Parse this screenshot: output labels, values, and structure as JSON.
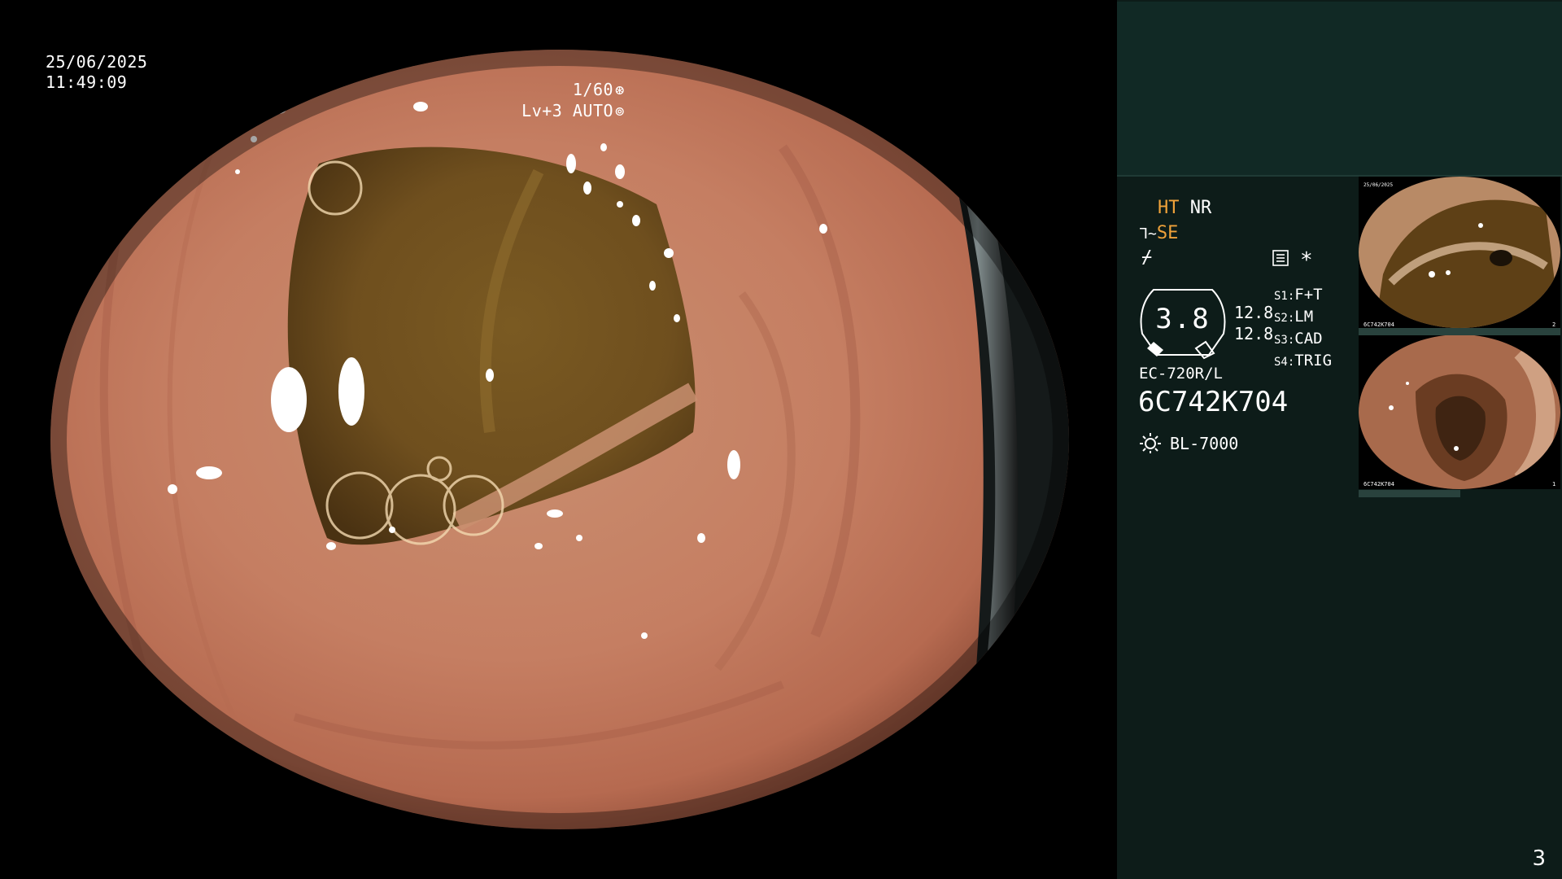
{
  "osd": {
    "date": "25/06/2025",
    "time": "11:49:09",
    "shutter": "1/60",
    "shutter_icon": "aperture-icon",
    "level": "Lv+3",
    "mode": "AUTO",
    "mode_icon": "iris-icon"
  },
  "settings": {
    "ht": "HT",
    "nr": "NR",
    "se_prefix": "⅂~",
    "se": "SE",
    "freeze_symbol": "⌿",
    "menu_icon": "menu-icon",
    "asterisk": "*",
    "zoom_value": "3.8",
    "value_1": "12.8",
    "value_2": "12.8",
    "switches": [
      {
        "key": "S1:",
        "value": "F+T"
      },
      {
        "key": "S2:",
        "value": "LM"
      },
      {
        "key": "S3:",
        "value": "CAD"
      },
      {
        "key": "S4:",
        "value": "TRIG"
      }
    ],
    "scope_model": "EC-720R/L",
    "scope_serial": "6C742K704",
    "light_icon": "sun-icon",
    "light_source": "BL-7000"
  },
  "thumbnails": [
    {
      "label": "captured-image-1",
      "caption": "6C742K704",
      "index": "2"
    },
    {
      "label": "captured-image-2",
      "caption": "6C742K704",
      "index": "1"
    }
  ],
  "page_number": "3",
  "colors": {
    "accent": "#f0a23a",
    "panel_bg": "#0d1c19",
    "panel_top": "#112925"
  }
}
